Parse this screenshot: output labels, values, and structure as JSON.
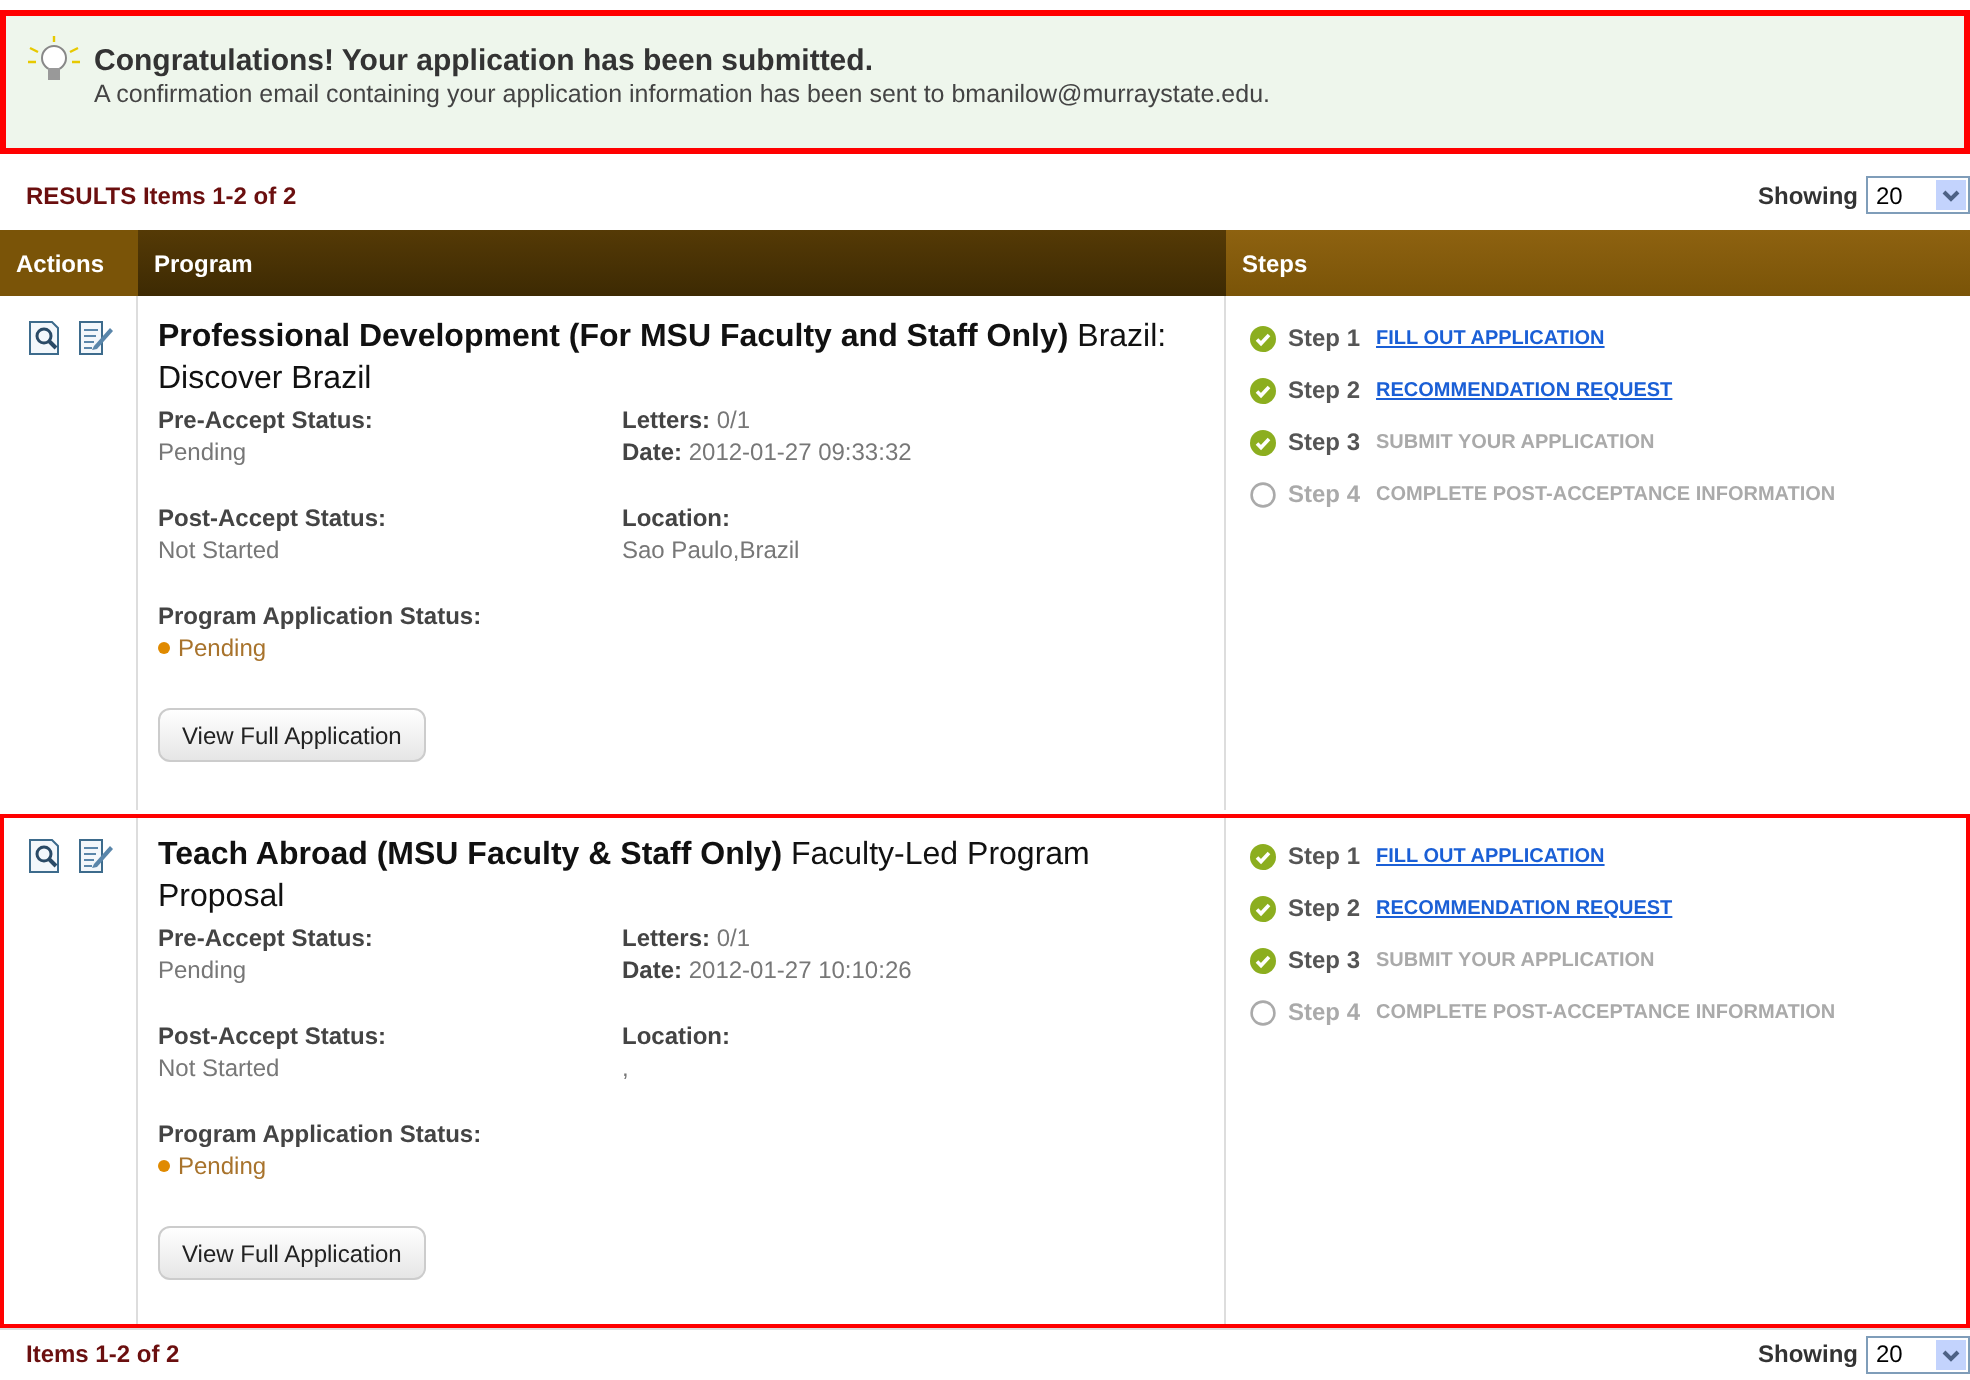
{
  "notice": {
    "title": "Congratulations! Your application has been submitted.",
    "message": "A confirmation email containing your application information has been sent to bmanilow@murraystate.edu.",
    "highlighted": true
  },
  "results_top": {
    "label": "RESULTS Items 1-2 of 2",
    "showing_label": "Showing",
    "showing_value": "20"
  },
  "table": {
    "columns": [
      "Actions",
      "Program",
      "Steps"
    ],
    "rows": [
      {
        "highlighted": false,
        "program_bold": "Professional Development (For MSU Faculty and Staff Only)",
        "program_name": "Brazil: Discover Brazil",
        "pre_accept_label": "Pre-Accept Status:",
        "pre_accept": "Pending",
        "letters_label": "Letters:",
        "letters": "0/1",
        "date_label": "Date:",
        "date": "2012-01-27 09:33:32",
        "post_accept_label": "Post-Accept Status:",
        "post_accept": "Not Started",
        "location_label": "Location:",
        "location": "Sao Paulo,Brazil",
        "app_status_label": "Program Application Status:",
        "app_status": "Pending",
        "button": "View Full Application",
        "steps": [
          {
            "label": "Step 1",
            "text": "FILL OUT APPLICATION",
            "kind": "link",
            "done": true
          },
          {
            "label": "Step 2",
            "text": "RECOMMENDATION REQUEST",
            "kind": "link",
            "done": true
          },
          {
            "label": "Step 3",
            "text": "SUBMIT YOUR APPLICATION",
            "kind": "plain",
            "done": true
          },
          {
            "label": "Step 4",
            "text": "COMPLETE POST-ACCEPTANCE INFORMATION",
            "kind": "plain",
            "done": false
          }
        ]
      },
      {
        "highlighted": true,
        "program_bold": "Teach Abroad (MSU Faculty & Staff Only)",
        "program_name": "Faculty-Led Program Proposal",
        "pre_accept_label": "Pre-Accept Status:",
        "pre_accept": "Pending",
        "letters_label": "Letters:",
        "letters": "0/1",
        "date_label": "Date:",
        "date": "2012-01-27 10:10:26",
        "post_accept_label": "Post-Accept Status:",
        "post_accept": "Not Started",
        "location_label": "Location:",
        "location": ",",
        "app_status_label": "Program Application Status:",
        "app_status": "Pending",
        "button": "View Full Application",
        "steps": [
          {
            "label": "Step 1",
            "text": "FILL OUT APPLICATION",
            "kind": "link",
            "done": true
          },
          {
            "label": "Step 2",
            "text": "RECOMMENDATION REQUEST",
            "kind": "link",
            "done": true
          },
          {
            "label": "Step 3",
            "text": "SUBMIT YOUR APPLICATION",
            "kind": "plain",
            "done": true
          },
          {
            "label": "Step 4",
            "text": "COMPLETE POST-ACCEPTANCE INFORMATION",
            "kind": "plain",
            "done": false
          }
        ]
      }
    ]
  },
  "results_bottom": {
    "label": "Items 1-2 of 2",
    "showing_label": "Showing",
    "showing_value": "20"
  }
}
